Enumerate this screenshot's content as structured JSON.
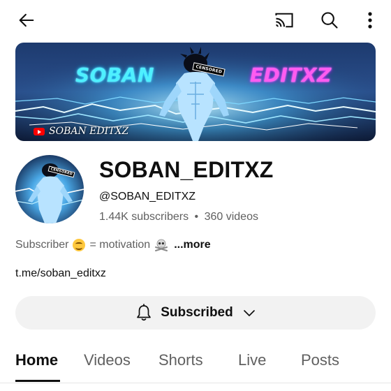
{
  "topbar": {
    "back_icon": "arrow-left-icon",
    "cast_icon": "cast-icon",
    "search_icon": "search-icon",
    "more_icon": "more-vertical-icon"
  },
  "banner": {
    "left_word": "SOBAN",
    "right_word": "EDITXZ",
    "handle_text": "SOBAN EDITXZ",
    "censor_text": "CENSORED"
  },
  "channel": {
    "name": "SOBAN_EDITXZ",
    "handle": "@SOBAN_EDITXZ",
    "subscribers": "1.44K subscribers",
    "separator": "•",
    "videos": "360 videos",
    "avatar_censor_text": "CENSORED"
  },
  "description": {
    "text_before": "Subscriber",
    "text_middle": "= motivation",
    "more_label": "...more"
  },
  "link": {
    "text": "t.me/soban_editxz"
  },
  "subscribe_button": {
    "label": "Subscribed",
    "bell_icon": "bell-icon",
    "chevron_icon": "chevron-down-icon"
  },
  "tabs": [
    {
      "label": "Home",
      "active": true
    },
    {
      "label": "Videos",
      "active": false
    },
    {
      "label": "Shorts",
      "active": false
    },
    {
      "label": "Live",
      "active": false
    },
    {
      "label": "Posts",
      "active": false
    }
  ],
  "colors": {
    "text_primary": "#0f0f0f",
    "text_secondary": "#606060",
    "button_bg": "#f2f2f2",
    "banner_left_word": "#4ef0ff",
    "banner_right_word": "#ff5cf0"
  }
}
